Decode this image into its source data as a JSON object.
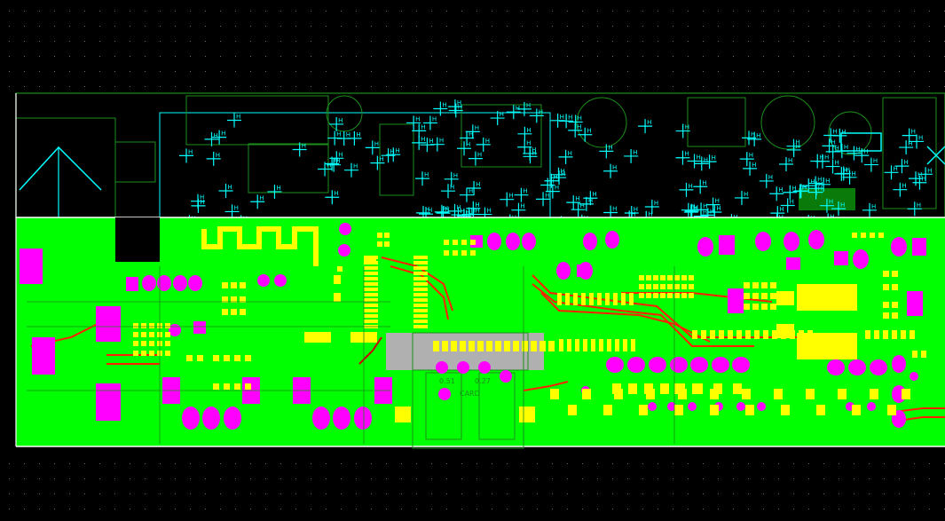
{
  "app": {
    "view": "pcb-layout-editor"
  },
  "colors": {
    "background": "#000000",
    "grid_dot": "#6b6b6b",
    "board_fill": "#00ff00",
    "board_outline": "#ffffff",
    "silkscreen": "#1b8f1b",
    "ratsnest": "#00ffff",
    "pad_smd": "#ffff00",
    "pad_thru": "#ff00ff",
    "trace": "#ff2000",
    "trace_alt": "#cc0000",
    "keepout": "#b0b0b0",
    "dark_pad": "#0a7a0a"
  },
  "labels": {
    "connector_text": "CARD",
    "dim_left": "0.51",
    "dim_right": "0.27",
    "marker_h": "H"
  }
}
